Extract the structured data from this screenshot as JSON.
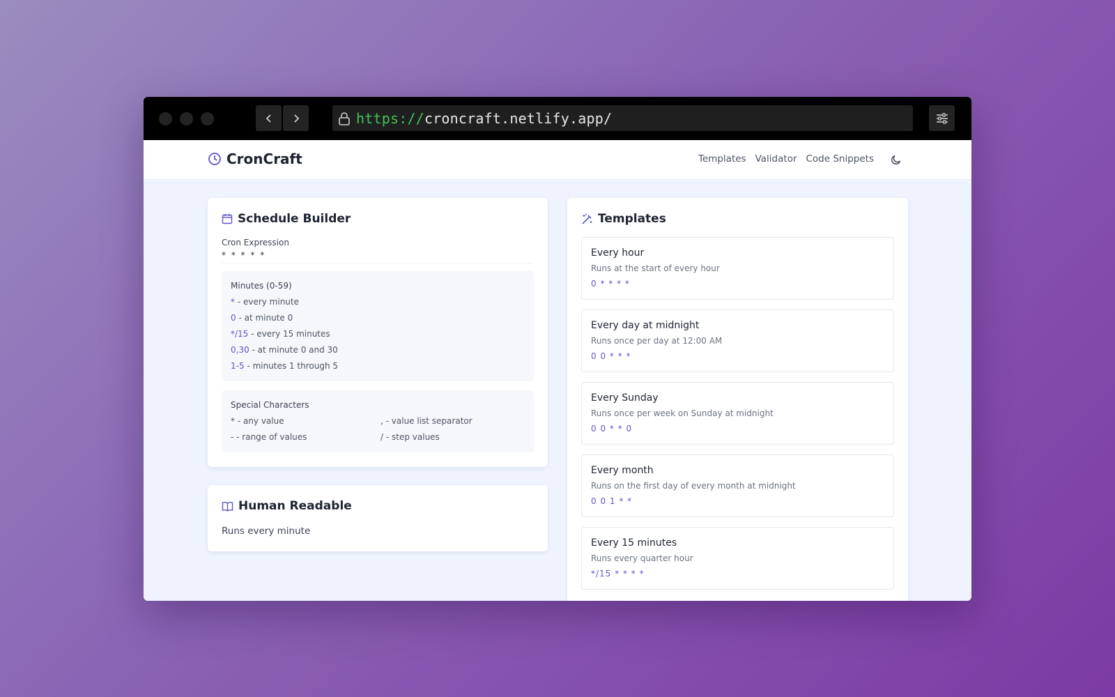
{
  "browser": {
    "url_protocol": "https://",
    "url_host": "croncraft.netlify.app/"
  },
  "app": {
    "name": "CronCraft",
    "nav": [
      "Templates",
      "Validator",
      "Code Snippets"
    ]
  },
  "builder": {
    "title": "Schedule Builder",
    "expression_label": "Cron Expression",
    "expression_value": "* * * * *",
    "minutes_title": "Minutes (0-59)",
    "minutes_rows": [
      {
        "code": "*",
        "text": " - every minute"
      },
      {
        "code": "0",
        "text": " - at minute 0"
      },
      {
        "code": "*/15",
        "text": " - every 15 minutes"
      },
      {
        "code": "0,30",
        "text": " - at minute 0 and 30"
      },
      {
        "code": "1-5",
        "text": " - minutes 1 through 5"
      }
    ],
    "special_title": "Special Characters",
    "special": [
      "* - any value",
      ", - value list separator",
      "- - range of values",
      "/ - step values"
    ]
  },
  "readable": {
    "title": "Human Readable",
    "text": "Runs every minute"
  },
  "templates": {
    "title": "Templates",
    "items": [
      {
        "name": "Every hour",
        "desc": "Runs at the start of every hour",
        "expr": "0 * * * *"
      },
      {
        "name": "Every day at midnight",
        "desc": "Runs once per day at 12:00 AM",
        "expr": "0 0 * * *"
      },
      {
        "name": "Every Sunday",
        "desc": "Runs once per week on Sunday at midnight",
        "expr": "0 0 * * 0"
      },
      {
        "name": "Every month",
        "desc": "Runs on the first day of every month at midnight",
        "expr": "0 0 1 * *"
      },
      {
        "name": "Every 15 minutes",
        "desc": "Runs every quarter hour",
        "expr": "*/15 * * * *"
      }
    ]
  },
  "colors": {
    "accent": "#5b58c6",
    "url_protocol": "#3fc45b"
  }
}
